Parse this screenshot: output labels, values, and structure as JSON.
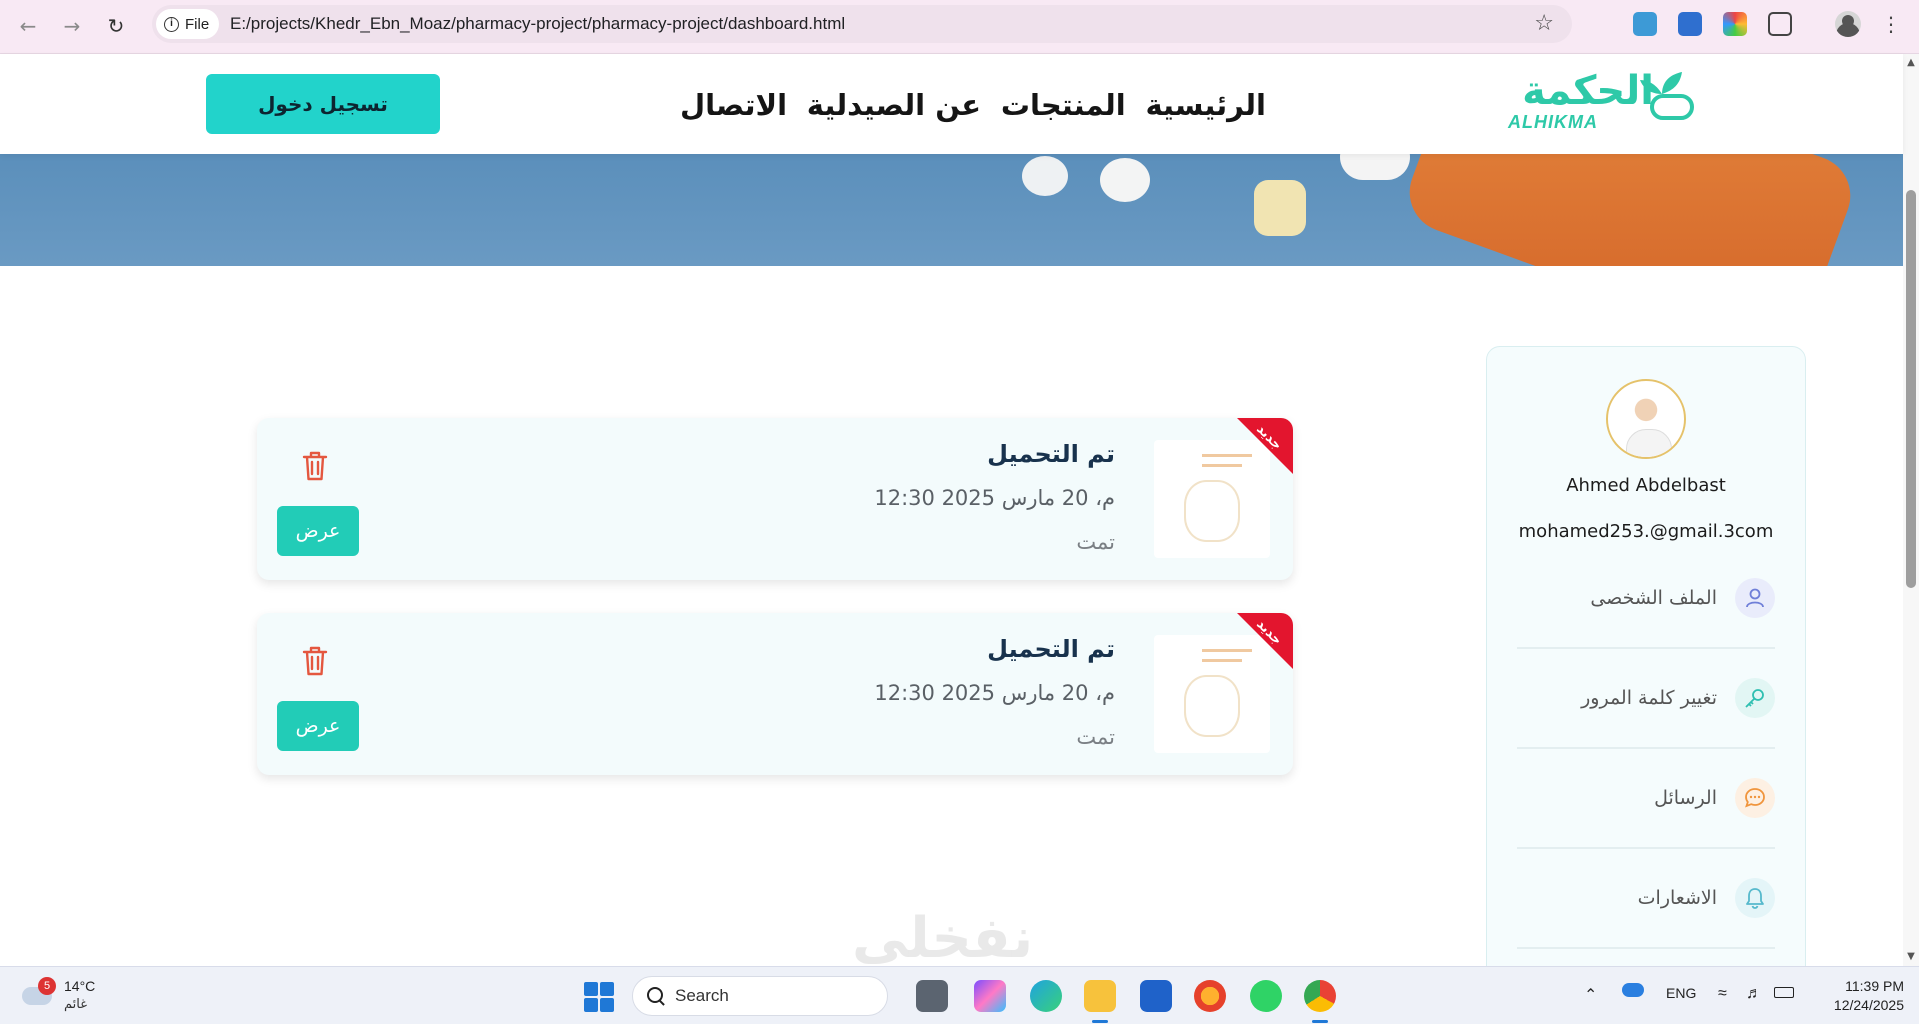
{
  "browser": {
    "site_chip_label": "File",
    "url": "E:/projects/Khedr_Ebn_Moaz/pharmacy-project/pharmacy-project/dashboard.html"
  },
  "header": {
    "login_label": "تسجيل دخول",
    "nav": [
      "الرئيسية",
      "المنتجات",
      "عن الصيدلية",
      "الاتصال"
    ],
    "logo_ar": "الحكمة",
    "logo_en": "ALHIKMA"
  },
  "profile": {
    "name": "Ahmed Abdelbast",
    "email": "mohamed253.@gmail.3com",
    "menu": [
      {
        "label": "الملف الشخصى",
        "icon": "user-icon"
      },
      {
        "label": "تغيير كلمة المرور",
        "icon": "key-icon"
      },
      {
        "label": "الرسائل",
        "icon": "chat-icon"
      },
      {
        "label": "الاشعارات",
        "icon": "bell-icon"
      }
    ]
  },
  "notifications": [
    {
      "badge": "جديد",
      "title": "تم التحميل",
      "datetime": "12:30 م، 20 مارس 2025",
      "status": "تمت",
      "view_label": "عرض"
    },
    {
      "badge": "جديد",
      "title": "تم التحميل",
      "datetime": "12:30 م، 20 مارس 2025",
      "status": "تمت",
      "view_label": "عرض"
    }
  ],
  "watermark": "نفخلي",
  "taskbar": {
    "weather_badge": "5",
    "temperature": "14°C",
    "condition": "غائم",
    "search_placeholder": "Search",
    "language": "ENG",
    "time": "11:39 PM",
    "date": "12/24/2025"
  },
  "colors": {
    "accent": "#22d3cb",
    "view_button": "#22ccb7",
    "ribbon": "#e3152e",
    "title": "#18324d"
  }
}
